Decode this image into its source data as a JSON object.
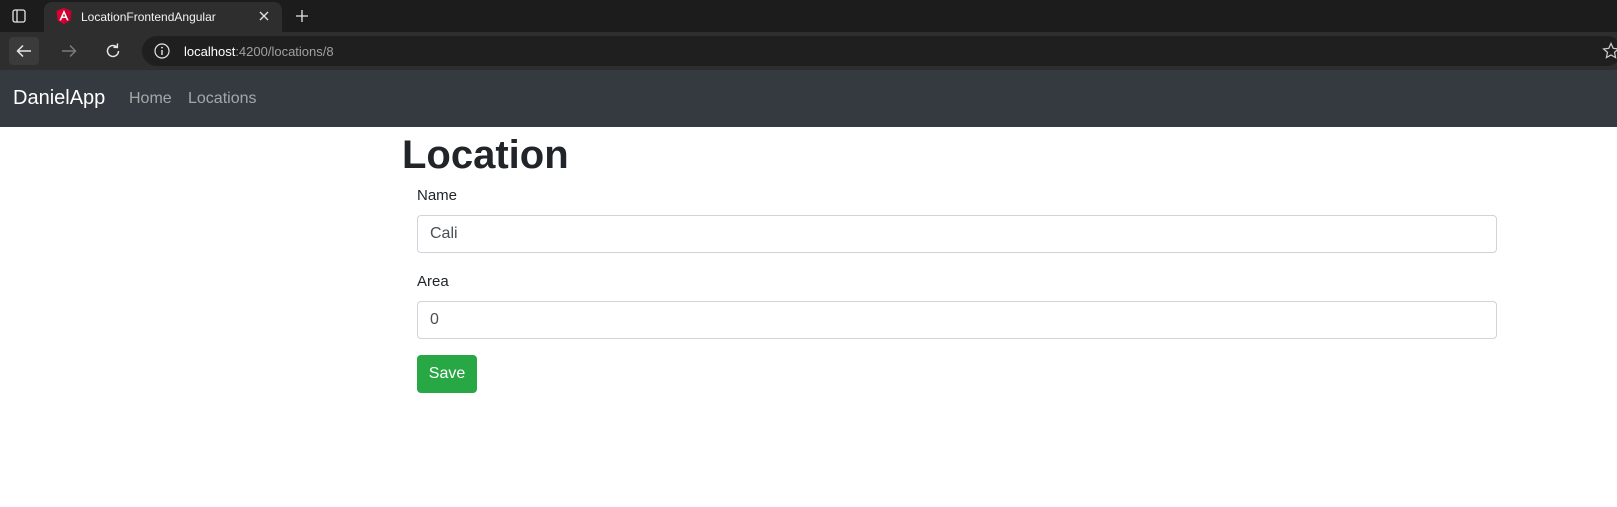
{
  "browser": {
    "tab_title": "LocationFrontendAngular",
    "url_host": "localhost",
    "url_rest": ":4200/locations/8",
    "icons": {
      "tab_actions": "tab-actions-icon",
      "favicon": "angular-logo-icon",
      "close": "close-icon",
      "new_tab": "plus-icon",
      "back": "arrow-left-icon",
      "forward": "arrow-right-icon",
      "reload": "reload-icon",
      "site_info": "info-icon",
      "favorite": "star-icon"
    }
  },
  "navbar": {
    "brand": "DanielApp",
    "links": [
      "Home",
      "Locations"
    ],
    "background": "#343a40"
  },
  "page": {
    "title": "Location",
    "form": {
      "name_label": "Name",
      "name_value": "Cali",
      "area_label": "Area",
      "area_value": "0",
      "save_label": "Save"
    },
    "accent": "#28a745"
  }
}
